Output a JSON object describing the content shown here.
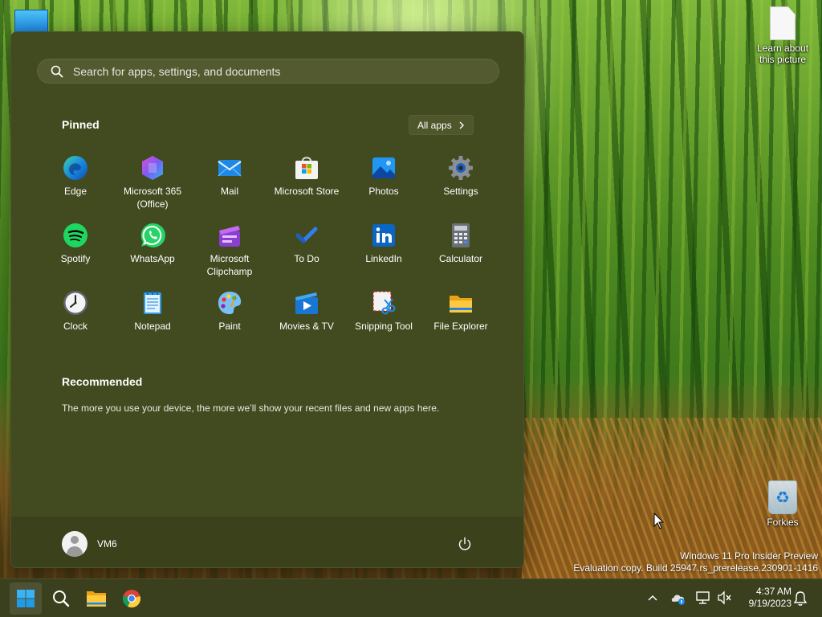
{
  "desktop": {
    "icons": [
      {
        "label": "Learn about this picture",
        "icon": "document-icon"
      },
      {
        "label": "Forkies",
        "icon": "recycle-bin-icon"
      }
    ],
    "watermark": {
      "line1": "Windows 11 Pro Insider Preview",
      "line2": "Evaluation copy. Build 25947.rs_prerelease.230901-1416"
    }
  },
  "start_menu": {
    "search": {
      "placeholder": "Search for apps, settings, and documents",
      "value": ""
    },
    "pinned_title": "Pinned",
    "all_apps_label": "All apps",
    "pinned": [
      {
        "label": "Edge",
        "icon": "edge-icon"
      },
      {
        "label": "Microsoft 365 (Office)",
        "icon": "m365-icon"
      },
      {
        "label": "Mail",
        "icon": "mail-icon"
      },
      {
        "label": "Microsoft Store",
        "icon": "store-icon"
      },
      {
        "label": "Photos",
        "icon": "photos-icon"
      },
      {
        "label": "Settings",
        "icon": "settings-gear-icon"
      },
      {
        "label": "Spotify",
        "icon": "spotify-icon"
      },
      {
        "label": "WhatsApp",
        "icon": "whatsapp-icon"
      },
      {
        "label": "Microsoft Clipchamp",
        "icon": "clipchamp-icon"
      },
      {
        "label": "To Do",
        "icon": "todo-check-icon"
      },
      {
        "label": "LinkedIn",
        "icon": "linkedin-icon"
      },
      {
        "label": "Calculator",
        "icon": "calculator-icon"
      },
      {
        "label": "Clock",
        "icon": "clock-icon"
      },
      {
        "label": "Notepad",
        "icon": "notepad-icon"
      },
      {
        "label": "Paint",
        "icon": "paint-palette-icon"
      },
      {
        "label": "Movies & TV",
        "icon": "movies-tv-icon"
      },
      {
        "label": "Snipping Tool",
        "icon": "snipping-tool-icon"
      },
      {
        "label": "File Explorer",
        "icon": "folder-icon"
      }
    ],
    "recommended_title": "Recommended",
    "recommended_text": "The more you use your device, the more we’ll show your recent files and new apps here.",
    "user_name": "VM6"
  },
  "taskbar": {
    "buttons": [
      {
        "name": "start",
        "icon": "windows-logo-icon",
        "active": true
      },
      {
        "name": "search",
        "icon": "search-icon"
      },
      {
        "name": "file-explorer",
        "icon": "folder-icon"
      },
      {
        "name": "chrome",
        "icon": "chrome-icon"
      }
    ],
    "tray_icons": [
      "chevron-up-icon",
      "onedrive-icon",
      "network-icon",
      "volume-muted-icon",
      "notifications-bell-icon"
    ],
    "time": "4:37 AM",
    "date": "9/19/2023"
  },
  "colors": {
    "start_menu_bg": "#424a1f",
    "taskbar_bg": "#3a3f1e",
    "accent": "#0078d4"
  }
}
